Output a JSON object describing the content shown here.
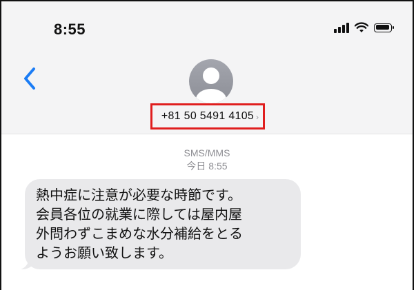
{
  "status_bar": {
    "time": "8:55",
    "signal_icon": "cellular-signal-icon",
    "wifi_icon": "wifi-icon",
    "battery_icon": "battery-icon"
  },
  "header": {
    "back_icon": "chevron-left-icon",
    "avatar_icon": "person-avatar-icon",
    "contact_number": "+81 50 5491 4105",
    "contact_chevron": "›",
    "accent_color": "#1a7cf5",
    "highlight_color": "#e01e1e",
    "background_color": "#f4f4f5"
  },
  "conversation": {
    "service_label": "SMS/MMS",
    "timestamp": "今日 8:55",
    "messages": [
      {
        "lines": [
          "熱中症に注意が必要な時節です。",
          "会員各位の就業に際しては屋内屋",
          "外問わずこまめな水分補給をとる",
          "ようお願い致します。"
        ],
        "bubble_color": "#e9e9eb"
      }
    ]
  }
}
